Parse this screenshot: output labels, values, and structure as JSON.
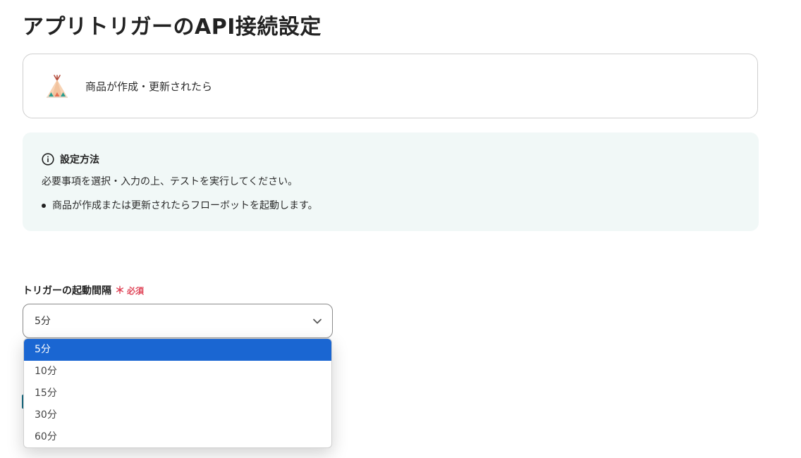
{
  "page": {
    "title": "アプリトリガーのAPI接続設定"
  },
  "trigger": {
    "label": "商品が作成・更新されたら",
    "app_icon": "teepee-icon"
  },
  "info": {
    "icon": "info-circle-icon",
    "heading": "設定方法",
    "description": "必要事項を選択・入力の上、テストを実行してください。",
    "items": [
      "商品が作成または更新されたらフローボットを起動します。"
    ]
  },
  "interval_field": {
    "label": "トリガーの起動間隔",
    "required_mark": "＊",
    "required_text": "必須",
    "selected_value": "5分",
    "options": [
      "5分",
      "10分",
      "15分",
      "30分",
      "60分"
    ],
    "selected_index": 0
  },
  "colors": {
    "accent": "#1a66d2",
    "required": "#e0475a",
    "info_background": "#f1f8f7"
  }
}
